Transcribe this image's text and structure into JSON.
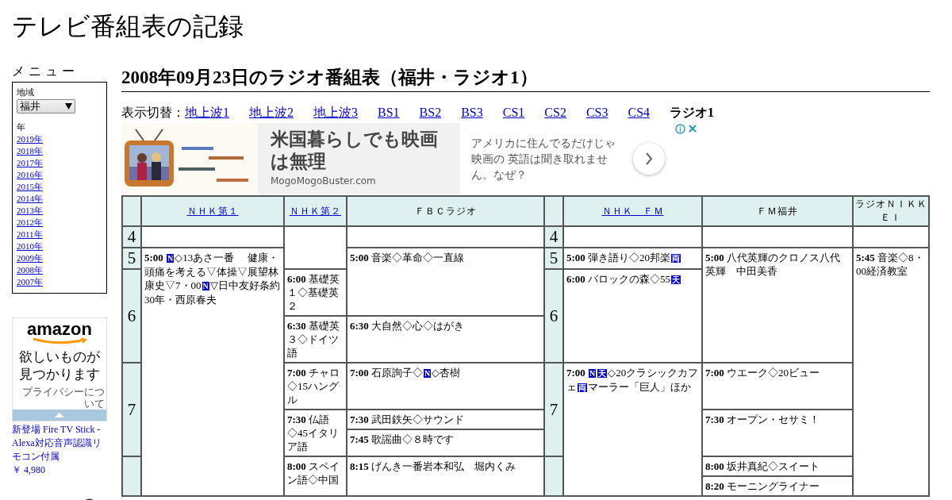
{
  "site_title": "テレビ番組表の記録",
  "sidebar": {
    "heading": "メ ニ ュ ー",
    "region_label": "地域",
    "region_select": {
      "value": "福井"
    },
    "year_label": "年",
    "years": [
      "2019年",
      "2018年",
      "2017年",
      "2016年",
      "2015年",
      "2014年",
      "2013年",
      "2012年",
      "2011年",
      "2010年",
      "2009年",
      "2008年",
      "2007年"
    ]
  },
  "sidebar_ad": {
    "logo": "amazon",
    "tagline": "欲しいものが見つかります",
    "privacy": "プライバシーについて",
    "product_link": "新登場 Fire TV Stick - Alexa対応音声認識リモコン付属",
    "price": "￥ 4,980"
  },
  "page_heading": "2008年09月23日のラジオ番組表（福井・ラジオ1）",
  "view_switch": {
    "label": "表示切替：",
    "tabs": [
      {
        "label": "地上波1",
        "selected": false
      },
      {
        "label": "地上波2",
        "selected": false
      },
      {
        "label": "地上波3",
        "selected": false
      },
      {
        "label": "BS1",
        "selected": false
      },
      {
        "label": "BS2",
        "selected": false
      },
      {
        "label": "BS3",
        "selected": false
      },
      {
        "label": "CS1",
        "selected": false
      },
      {
        "label": "CS2",
        "selected": false
      },
      {
        "label": "CS3",
        "selected": false
      },
      {
        "label": "CS4",
        "selected": false
      },
      {
        "label": "ラジオ1",
        "selected": true
      }
    ]
  },
  "banner_ad": {
    "headline": "米国暮らしでも映画は無理",
    "domain": "MogoMogoBuster.com",
    "body": "アメリカに住んでるだけじゃ映画の 英語は聞き取れません。なぜ？"
  },
  "schedule": {
    "columns": [
      {
        "kind": "hour",
        "labels": [
          "4",
          "5",
          "6",
          "7"
        ]
      },
      {
        "kind": "channel",
        "name": "ＮＨＫ第１",
        "link": true,
        "programs": [
          {
            "time": "5:00",
            "parts": [
              {
                "kind": "badge",
                "text": "N"
              },
              {
                "kind": "text",
                "text": "◇13あさ一番　 健康・頭痛を考える▽体操▽展望林康史▽7・00"
              },
              {
                "kind": "badge",
                "text": "N"
              },
              {
                "kind": "text",
                "text": "▽日中友好条約30年・西原春夫"
              }
            ]
          }
        ]
      },
      {
        "kind": "channel",
        "name": "ＮＨＫ第２",
        "link": true,
        "programs": [
          {
            "time": "6:00",
            "parts": [
              {
                "kind": "text",
                "text": "基礎英１◇基礎英２"
              }
            ]
          },
          {
            "time": "6:30",
            "parts": [
              {
                "kind": "text",
                "text": "基礎英３◇ドイツ語"
              }
            ]
          },
          {
            "time": "7:00",
            "parts": [
              {
                "kind": "text",
                "text": "チャロ◇15ハングル"
              }
            ]
          },
          {
            "time": "7:30",
            "parts": [
              {
                "kind": "text",
                "text": "仏語◇45イタリア語"
              }
            ]
          },
          {
            "time": "8:00",
            "parts": [
              {
                "kind": "text",
                "text": "スペイン語◇中国"
              }
            ]
          }
        ]
      },
      {
        "kind": "channel",
        "name": "ＦＢＣラジオ",
        "link": false,
        "programs": [
          {
            "time": "5:00",
            "parts": [
              {
                "kind": "text",
                "text": "音楽◇革命◇一直線"
              }
            ]
          },
          {
            "time": "6:30",
            "parts": [
              {
                "kind": "text",
                "text": "大自然◇心◇はがき"
              }
            ]
          },
          {
            "time": "7:00",
            "parts": [
              {
                "kind": "text",
                "text": "石原詢子◇"
              },
              {
                "kind": "badge",
                "text": "N"
              },
              {
                "kind": "text",
                "text": "◇杏樹"
              }
            ]
          },
          {
            "time": "7:30",
            "parts": [
              {
                "kind": "text",
                "text": "武田鉄矢◇サウンド"
              }
            ]
          },
          {
            "time": "7:45",
            "parts": [
              {
                "kind": "text",
                "text": "歌謡曲◇８時です"
              }
            ]
          },
          {
            "time": "8:15",
            "parts": [
              {
                "kind": "text",
                "text": "げんき一番岩本和弘　堀内くみ"
              }
            ]
          }
        ]
      },
      {
        "kind": "hour",
        "labels": [
          "4",
          "5",
          "6",
          "7"
        ]
      },
      {
        "kind": "channel",
        "name": "ＮＨＫ　ＦＭ",
        "link": true,
        "programs": [
          {
            "time": "5:00",
            "parts": [
              {
                "kind": "text",
                "text": "弾き語り◇20邦楽"
              },
              {
                "kind": "badge",
                "text": "両"
              }
            ]
          },
          {
            "time": "6:00",
            "parts": [
              {
                "kind": "text",
                "text": "バロックの森◇55"
              },
              {
                "kind": "badge",
                "text": "天"
              }
            ]
          },
          {
            "time": "7:00",
            "parts": [
              {
                "kind": "badge",
                "text": "N"
              },
              {
                "kind": "badge",
                "text": "天"
              },
              {
                "kind": "text",
                "text": "◇20クラシックカフェ"
              },
              {
                "kind": "badge",
                "text": "両"
              },
              {
                "kind": "text",
                "text": "マーラー「巨人」ほか"
              }
            ]
          }
        ]
      },
      {
        "kind": "channel",
        "name": "ＦＭ福井",
        "link": false,
        "programs": [
          {
            "time": "5:00",
            "parts": [
              {
                "kind": "text",
                "text": "八代英輝のクロノス八代英輝　中田美香"
              }
            ]
          },
          {
            "time": "7:00",
            "parts": [
              {
                "kind": "text",
                "text": "ウエーク◇20ビュー"
              }
            ]
          },
          {
            "time": "7:30",
            "parts": [
              {
                "kind": "text",
                "text": "オープン・セサミ！"
              }
            ]
          },
          {
            "time": "8:00",
            "parts": [
              {
                "kind": "text",
                "text": "坂井真紀◇スイート"
              }
            ]
          },
          {
            "time": "8:20",
            "parts": [
              {
                "kind": "text",
                "text": "モーニングライナー"
              }
            ]
          }
        ]
      },
      {
        "kind": "channel",
        "name": "ラジオＮＩＫＫＥＩ",
        "link": false,
        "programs": [
          {
            "time": "5:45",
            "parts": [
              {
                "kind": "text",
                "text": "音楽◇8・00経済教室"
              }
            ]
          }
        ]
      }
    ]
  }
}
